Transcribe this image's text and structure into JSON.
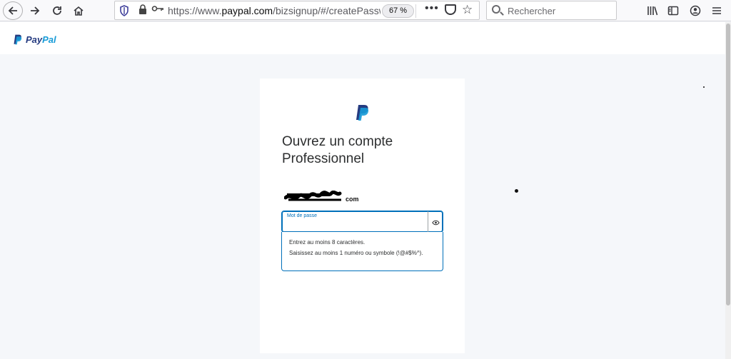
{
  "browser": {
    "url_host": "https://www.",
    "url_domain": "paypal.com",
    "url_path": "/bizsignup/#/createPasswo",
    "zoom": "67 %",
    "search_placeholder": "Rechercher",
    "more_icon": "•••"
  },
  "header": {
    "logo_pay": "Pay",
    "logo_pal": "Pal"
  },
  "card": {
    "title": "Ouvrez un compte Professionnel",
    "email_suffix": "com",
    "password_label": "Mot de passe",
    "password_value": "",
    "hints": [
      "Entrez au moins 8 caractères.",
      "Saisissez au moins 1 numéro ou symbole (!@#$%^)."
    ]
  },
  "colors": {
    "paypal_dark": "#253b80",
    "paypal_light": "#179bd7",
    "focus_blue": "#0070ba"
  }
}
